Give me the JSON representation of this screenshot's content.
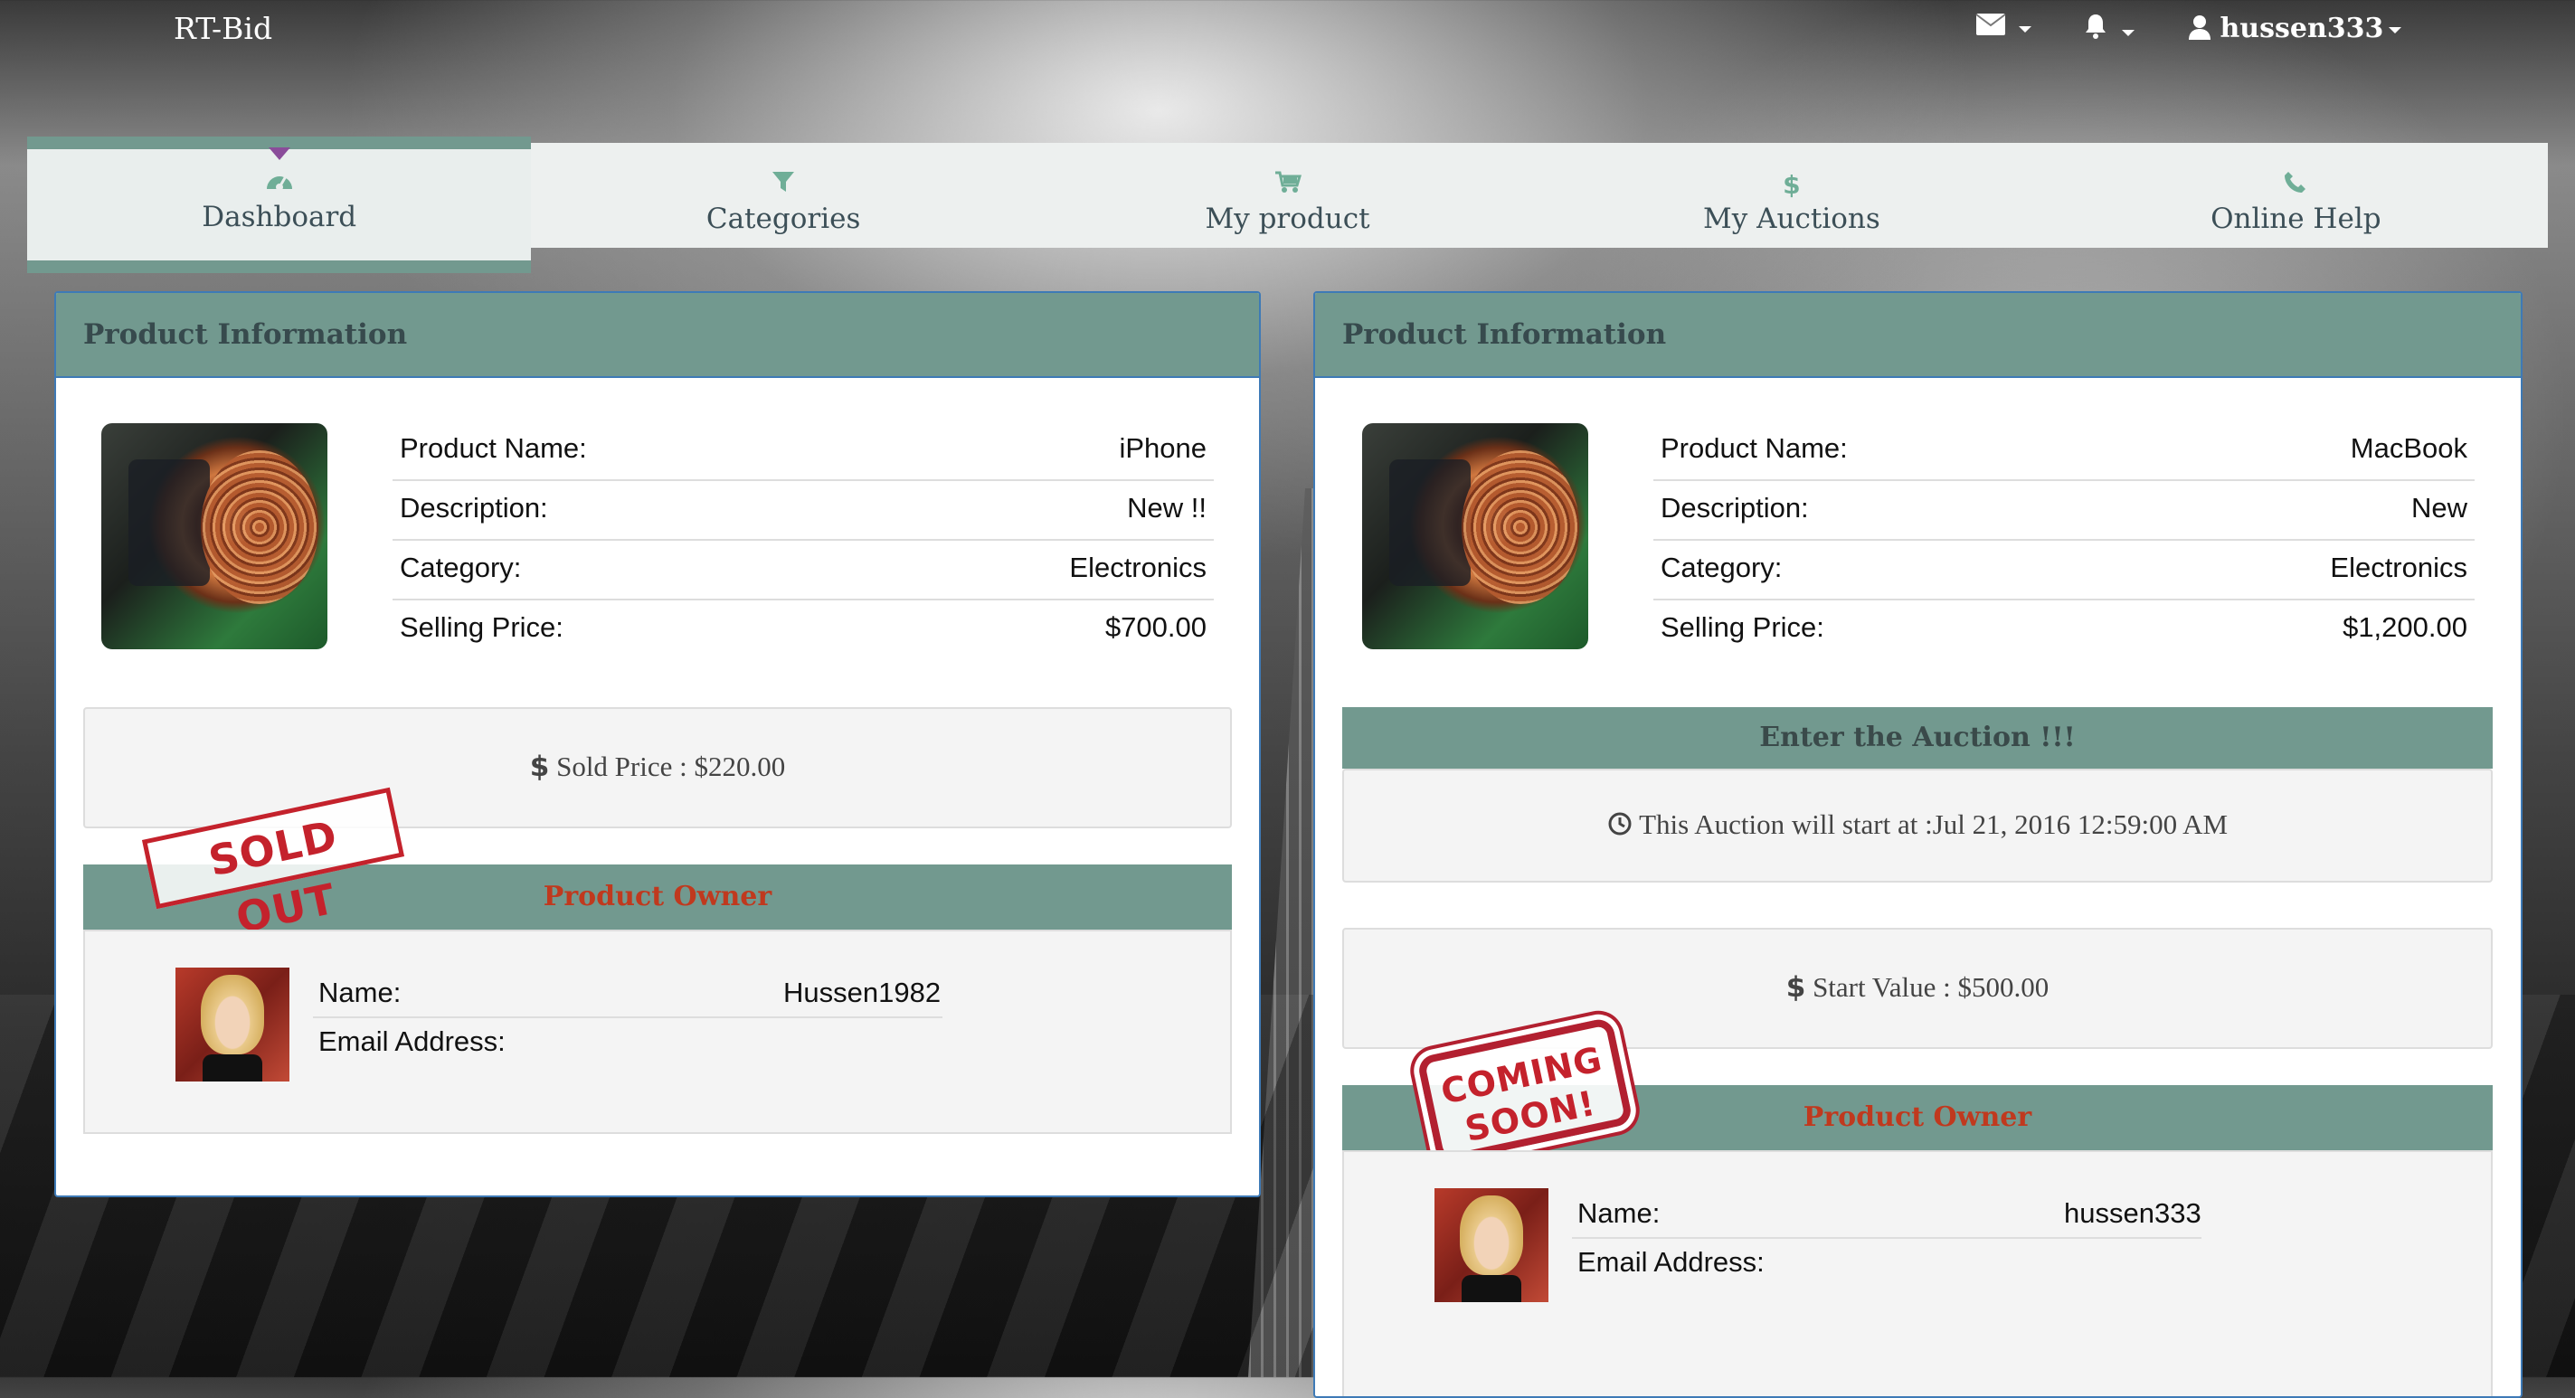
{
  "app": {
    "brand": "RT-Bid",
    "user": "hussen333"
  },
  "topbar": {
    "mail_icon": "envelope-icon",
    "bell_icon": "bell-icon",
    "user_icon": "user-icon"
  },
  "nav": [
    {
      "label": "Dashboard",
      "icon": "dashboard-icon",
      "active": true
    },
    {
      "label": "Categories",
      "icon": "filter-icon",
      "active": false
    },
    {
      "label": "My product",
      "icon": "cart-icon",
      "active": false
    },
    {
      "label": "My Auctions",
      "icon": "dollar-icon",
      "active": false
    },
    {
      "label": "Online Help",
      "icon": "phone-icon",
      "active": false
    }
  ],
  "colors": {
    "accent": "#72998f",
    "panel_border": "#3e7ab6",
    "owner_title": "#c0391e",
    "stamp_red": "#c4222c"
  },
  "left": {
    "title": "Product Information",
    "fields": [
      {
        "k": "Product Name:",
        "v": "iPhone"
      },
      {
        "k": "Description:",
        "v": "New !!"
      },
      {
        "k": "Category:",
        "v": "Electronics"
      },
      {
        "k": "Selling Price:",
        "v": "$700.00"
      }
    ],
    "sold_price": "Sold Price : $220.00",
    "stamp": "SOLD OUT",
    "owner_title": "Product Owner",
    "owner_name_label": "Name:",
    "owner_name": "Hussen1982",
    "owner_email_label": "Email Address:"
  },
  "right": {
    "title": "Product Information",
    "fields": [
      {
        "k": "Product Name:",
        "v": "MacBook"
      },
      {
        "k": "Description:",
        "v": "New"
      },
      {
        "k": "Category:",
        "v": "Electronics"
      },
      {
        "k": "Selling Price:",
        "v": "$1,200.00"
      }
    ],
    "enter_auction": "Enter the Auction !!!",
    "auction_start": "This Auction will start at :Jul 21, 2016 12:59:00 AM",
    "start_value": "Start Value : $500.00",
    "stamp_line1": "COMING",
    "stamp_line2": "SOON!",
    "owner_title": "Product Owner",
    "owner_name_label": "Name:",
    "owner_name": "hussen333",
    "owner_email_label": "Email Address:"
  }
}
